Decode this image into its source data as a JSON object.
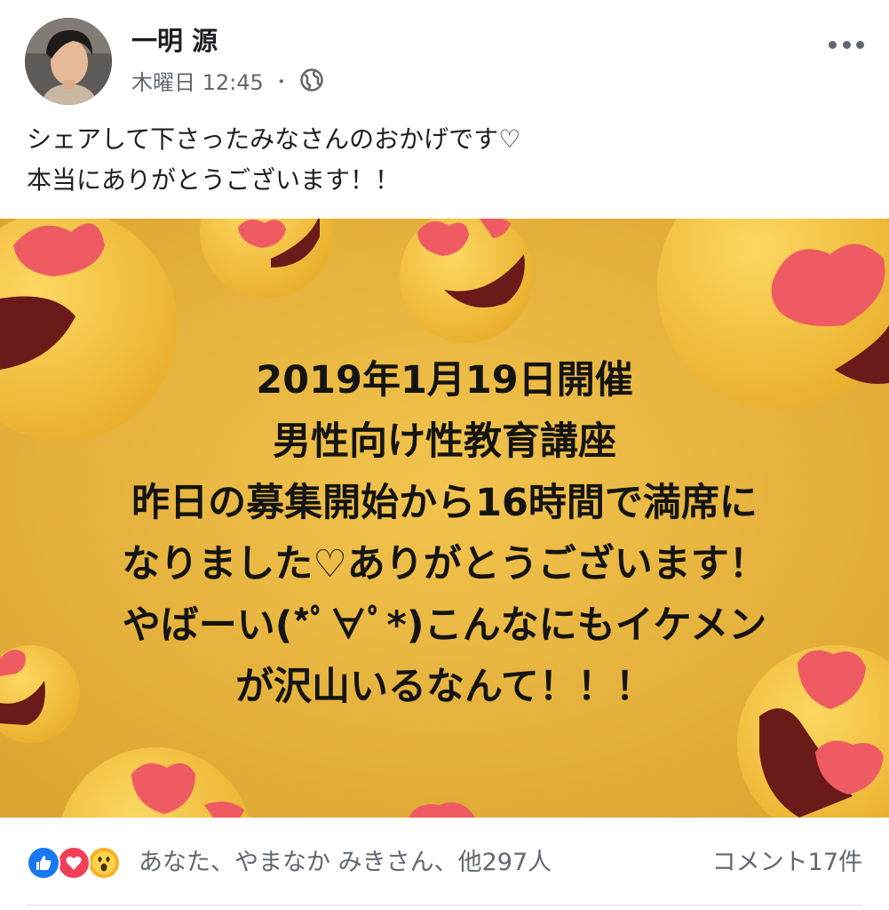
{
  "post": {
    "author_name": "一明 源",
    "timestamp": "木曜日 12:45",
    "separator": "・",
    "privacy_icon": "globe-icon",
    "more_icon": "more-options-icon",
    "text_lines": [
      "シェアして下さったみなさんのおかげです♡",
      "本当にありがとうございます！！"
    ]
  },
  "image": {
    "text_lines": [
      "2019年1月19日開催",
      "男性向け性教育講座",
      "昨日の募集開始から16時間で満席に",
      "なりました♡ありがとうございます！",
      "やばーい(*ﾟ∀ﾟ*)こんなにもイケメン",
      "が沢山いるなんて！！！"
    ],
    "background_color": "#eab43a"
  },
  "reactions": {
    "icons": [
      "like-icon",
      "love-icon",
      "wow-icon"
    ],
    "summary": "あなた、やまなか みきさん、他297人",
    "comment_count": "コメント17件"
  },
  "colors": {
    "like": "#1877f2",
    "love": "#f33e58",
    "wow": "#f7b125",
    "secondary_text": "#606770"
  }
}
